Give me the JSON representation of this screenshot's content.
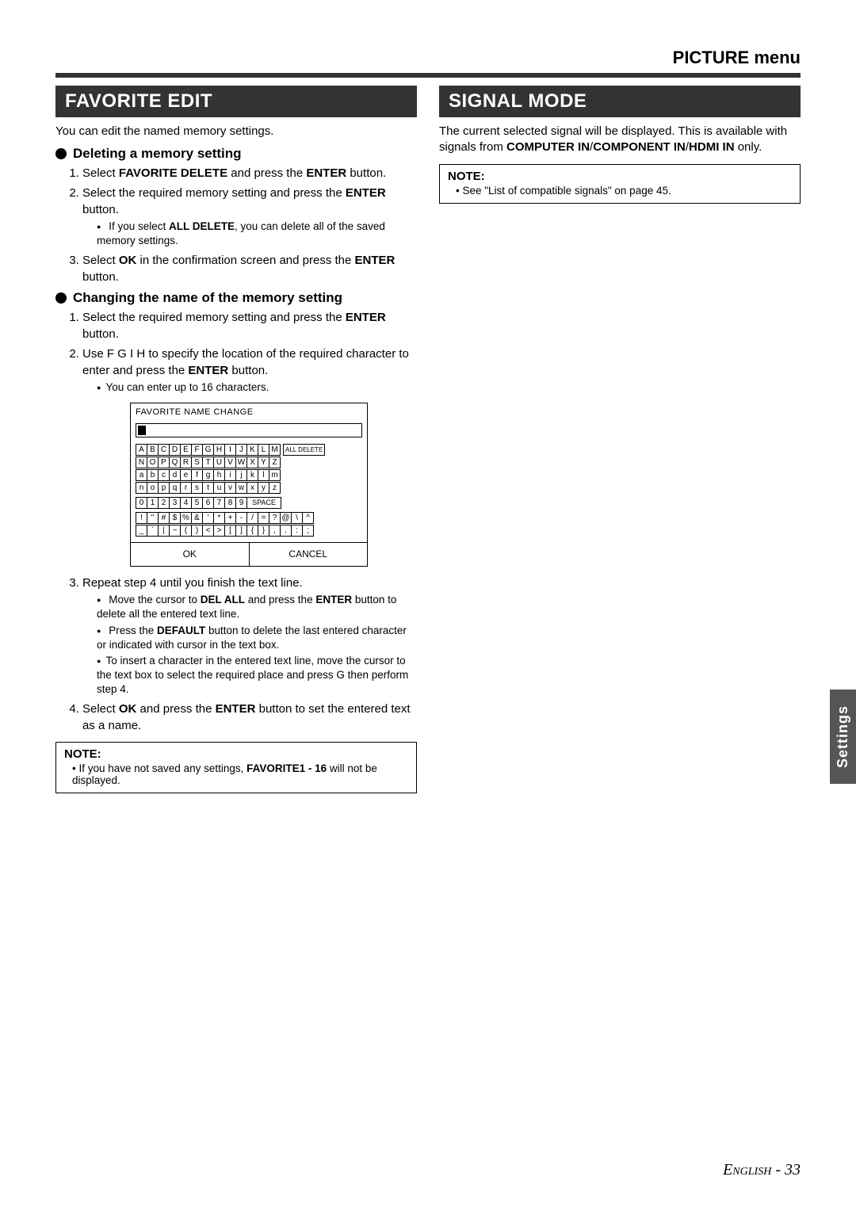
{
  "header": {
    "menu_title": "PICTURE menu"
  },
  "side_tab": "Settings",
  "footer": {
    "language": "English",
    "sep": " - ",
    "page": "33"
  },
  "left": {
    "section_title": "FAVORITE EDIT",
    "intro": "You can edit the named memory settings.",
    "sub1_title": "Deleting a memory setting",
    "sub1_steps": {
      "s1_a": "Select ",
      "s1_b": "FAVORITE DELETE",
      "s1_c": " and press the ",
      "s1_d": "ENTER",
      "s1_e": " button.",
      "s2_a": "Select the required memory setting and press the ",
      "s2_b": "ENTER",
      "s2_c": " button.",
      "s2_sub_a": "If you select ",
      "s2_sub_b": "ALL DELETE",
      "s2_sub_c": ", you can delete all of the saved memory settings.",
      "s3_a": "Select ",
      "s3_b": "OK",
      "s3_c": " in the confirmation screen and press the ",
      "s3_d": "ENTER",
      "s3_e": " button."
    },
    "sub2_title": "Changing the name of the memory setting",
    "sub2_steps": {
      "s1_a": "Select the required memory setting and press the ",
      "s1_b": "ENTER",
      "s1_c": " button.",
      "s2_a": "Use F G I H to specify the location of the required character to enter and press the ",
      "s2_b": "ENTER",
      "s2_c": " button.",
      "s2_sub": "You can enter up to 16 characters.",
      "s3": "Repeat step 4 until you finish the text line.",
      "s3_sub1_a": "Move the cursor to ",
      "s3_sub1_b": "DEL ALL",
      "s3_sub1_c": " and press the ",
      "s3_sub1_d": "ENTER",
      "s3_sub1_e": " button to delete all the entered text line.",
      "s3_sub2_a": "Press the ",
      "s3_sub2_b": "DEFAULT",
      "s3_sub2_c": " button to delete the last entered character or indicated with cursor in the text box.",
      "s3_sub3": "To insert a character in the entered text line, move the cursor to the text box to select the required place and press G then perform step 4.",
      "s4_a": "Select ",
      "s4_b": "OK",
      "s4_c": " and press the ",
      "s4_d": "ENTER",
      "s4_e": " button to set the entered text as a name."
    },
    "osd": {
      "title": "FAVORITE NAME CHANGE",
      "row_upper1": [
        "A",
        "B",
        "C",
        "D",
        "E",
        "F",
        "G",
        "H",
        "I",
        "J",
        "K",
        "L",
        "M"
      ],
      "row_upper2": [
        "N",
        "O",
        "P",
        "Q",
        "R",
        "S",
        "T",
        "U",
        "V",
        "W",
        "X",
        "Y",
        "Z"
      ],
      "row_lower1": [
        "a",
        "b",
        "c",
        "d",
        "e",
        "f",
        "g",
        "h",
        "i",
        "j",
        "k",
        "l",
        "m"
      ],
      "row_lower2": [
        "n",
        "o",
        "p",
        "q",
        "r",
        "s",
        "t",
        "u",
        "v",
        "w",
        "x",
        "y",
        "z"
      ],
      "row_num": [
        "0",
        "1",
        "2",
        "3",
        "4",
        "5",
        "6",
        "7",
        "8",
        "9"
      ],
      "space": "SPACE",
      "row_sym1": [
        "!",
        "\"",
        "#",
        "$",
        "%",
        "&",
        "'",
        "*",
        "+",
        "-",
        "/",
        "=",
        "?",
        "@",
        "\\",
        "^"
      ],
      "row_sym2": [
        "_",
        "`",
        "|",
        "~",
        "(",
        ")",
        "<",
        ">",
        "[",
        "]",
        "{",
        "}",
        ",",
        ".",
        ":",
        ";"
      ],
      "all_delete": "ALL DELETE",
      "ok": "OK",
      "cancel": "CANCEL"
    },
    "note": {
      "title": "NOTE:",
      "text_a": "If you have not saved any settings, ",
      "text_b": "FAVORITE1 - 16",
      "text_c": " will not be displayed."
    }
  },
  "right": {
    "section_title": "SIGNAL MODE",
    "intro_a": "The current selected signal will be displayed. This is available with signals from ",
    "intro_b": "COMPUTER IN",
    "intro_c": "/",
    "intro_d": "COMPONENT IN",
    "intro_e": "/",
    "intro_f": "HDMI IN",
    "intro_g": " only.",
    "note": {
      "title": "NOTE:",
      "text": "See \"List of compatible signals\" on page 45."
    }
  }
}
